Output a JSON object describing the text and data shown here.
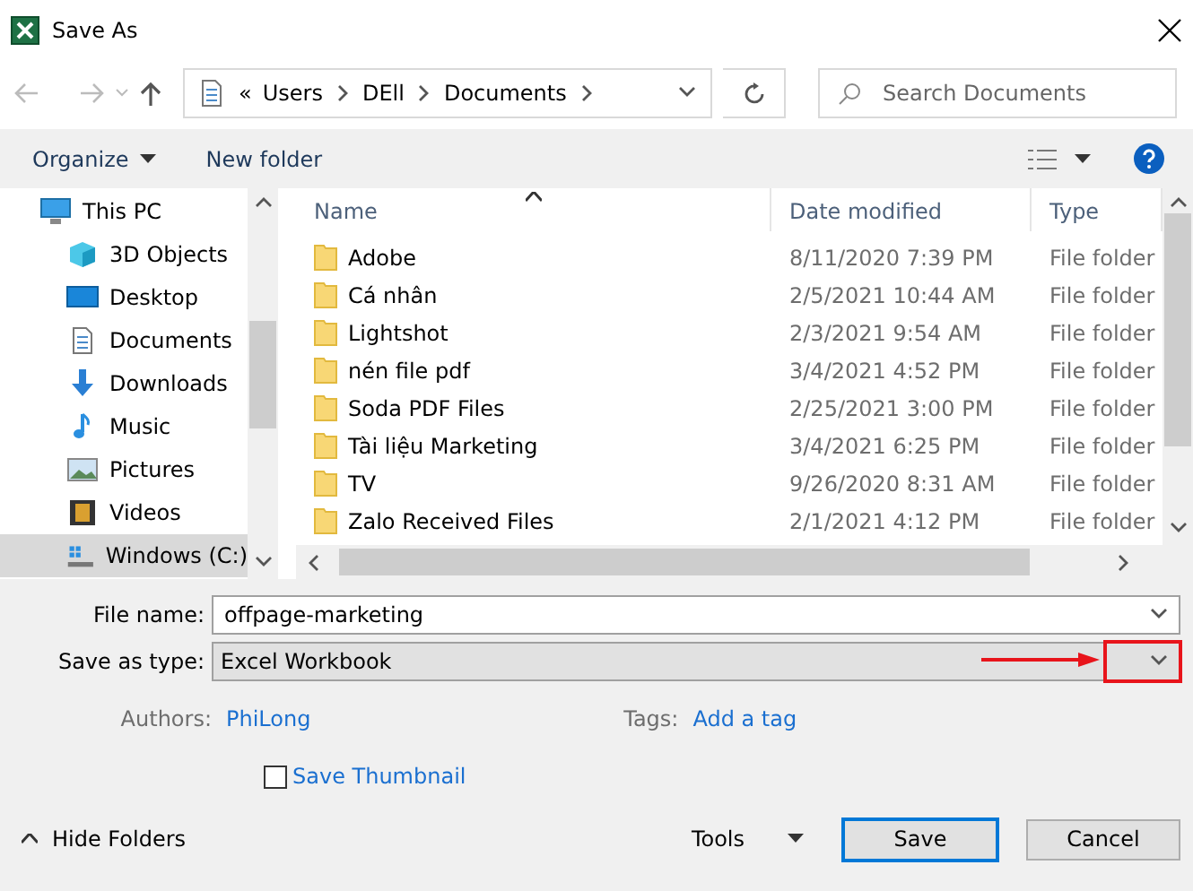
{
  "window": {
    "title": "Save As"
  },
  "breadcrumb": {
    "overflow": "«",
    "parts": [
      "Users",
      "DEll",
      "Documents"
    ]
  },
  "search": {
    "placeholder": "Search Documents"
  },
  "toolbar": {
    "organize": "Organize",
    "new_folder": "New folder"
  },
  "sidebar": {
    "items": [
      {
        "label": "This PC",
        "kind": "pc",
        "selected": false,
        "children": [
          {
            "label": "3D Objects",
            "kind": "cube",
            "selected": false
          },
          {
            "label": "Desktop",
            "kind": "desktop",
            "selected": false
          },
          {
            "label": "Documents",
            "kind": "document",
            "selected": false
          },
          {
            "label": "Downloads",
            "kind": "download",
            "selected": false
          },
          {
            "label": "Music",
            "kind": "music",
            "selected": false
          },
          {
            "label": "Pictures",
            "kind": "picture",
            "selected": false
          },
          {
            "label": "Videos",
            "kind": "video",
            "selected": false
          },
          {
            "label": "Windows (C:)",
            "kind": "drive",
            "selected": true
          }
        ]
      }
    ]
  },
  "table": {
    "columns": [
      "Name",
      "Date modified",
      "Type"
    ],
    "rows": [
      [
        "Adobe",
        "8/11/2020 7:39 PM",
        "File folder"
      ],
      [
        "Cá nhân",
        "2/5/2021 10:44 AM",
        "File folder"
      ],
      [
        "Lightshot",
        "2/3/2021 9:54 AM",
        "File folder"
      ],
      [
        "nén file pdf",
        "3/4/2021 4:52 PM",
        "File folder"
      ],
      [
        "Soda PDF Files",
        "2/25/2021 3:00 PM",
        "File folder"
      ],
      [
        "Tài liệu Marketing",
        "3/4/2021 6:25 PM",
        "File folder"
      ],
      [
        "TV",
        "9/26/2020 8:31 AM",
        "File folder"
      ],
      [
        "Zalo Received Files",
        "2/1/2021 4:12 PM",
        "File folder"
      ]
    ]
  },
  "form": {
    "file_name_label": "File name:",
    "file_name": "offpage-marketing",
    "save_type_label": "Save as type:",
    "save_type": "Excel Workbook",
    "save_type_highlighted": true,
    "authors_label": "Authors:",
    "authors": "PhiLong",
    "tags_label": "Tags:",
    "tags": "Add a tag",
    "thumbnail_label": "Save Thumbnail",
    "thumbnail_checked": false
  },
  "footer": {
    "hide_folders": "Hide Folders",
    "tools": "Tools",
    "save": "Save",
    "cancel": "Cancel"
  }
}
